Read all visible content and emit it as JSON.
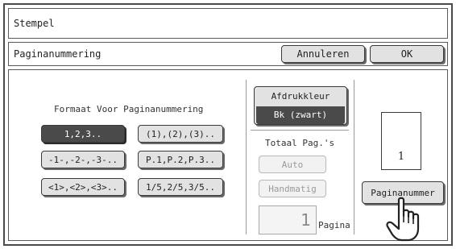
{
  "window": {
    "title": "Stempel"
  },
  "header": {
    "title": "Paginanummering",
    "cancel_label": "Annuleren",
    "ok_label": "OK"
  },
  "format": {
    "heading": "Formaat Voor Paginanummering",
    "options": [
      {
        "label": "1,2,3..",
        "selected": true
      },
      {
        "label": "(1),(2),(3)..",
        "selected": false
      },
      {
        "label": "-1-,-2-,-3-..",
        "selected": false
      },
      {
        "label": "P.1,P.2,P.3..",
        "selected": false
      },
      {
        "label": "<1>,<2>,<3>..",
        "selected": false
      },
      {
        "label": "1/5,2/5,3/5..",
        "selected": false
      }
    ]
  },
  "print_color": {
    "label": "Afdrukkleur",
    "value": "Bk (zwart)"
  },
  "total_pages": {
    "label": "Totaal Pag.'s",
    "auto_label": "Auto",
    "manual_label": "Handmatig",
    "page_value": "1",
    "page_unit": "Pagina"
  },
  "preview": {
    "page_number": "1",
    "button_label": "Paginanummer"
  },
  "icons": {
    "pointer": "hand-pointer-icon"
  },
  "colors": {
    "selected_bg": "#4a4a4a",
    "button_bg": "#e2e2e2",
    "disabled_text": "#9a9a9a"
  }
}
